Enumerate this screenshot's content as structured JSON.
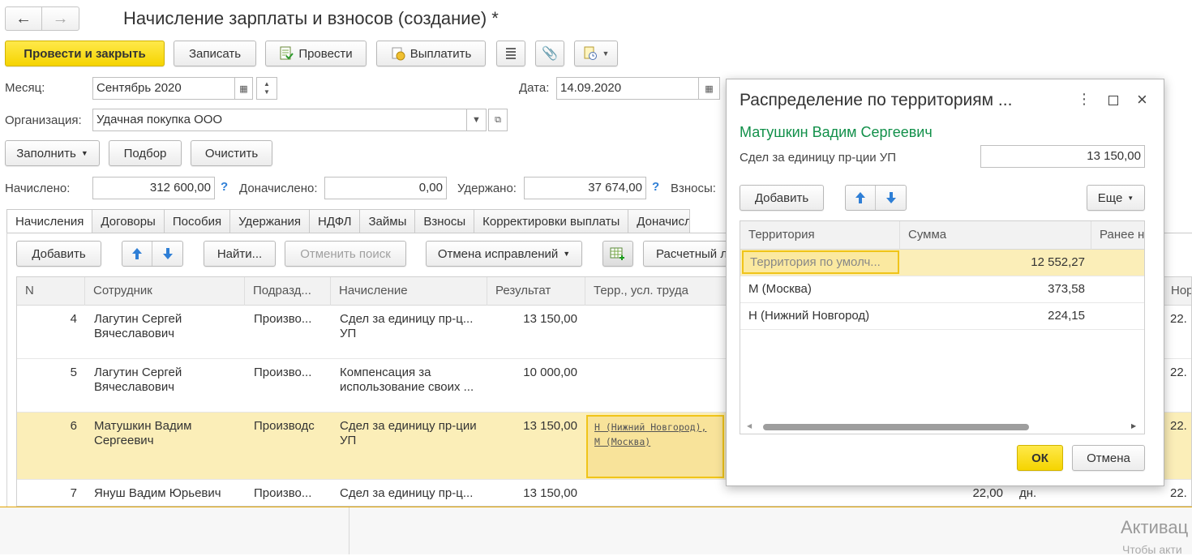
{
  "header": {
    "title": "Начисление зарплаты и взносов (создание) *"
  },
  "toolbar": {
    "post_close": "Провести и закрыть",
    "save": "Записать",
    "post": "Провести",
    "pay": "Выплатить"
  },
  "form": {
    "month_label": "Месяц:",
    "month_value": "Сентябрь 2020",
    "date_label": "Дата:",
    "date_value": "14.09.2020",
    "org_label": "Организация:",
    "org_value": "Удачная покупка ООО"
  },
  "actions": {
    "fill": "Заполнить",
    "select": "Подбор",
    "clear": "Очистить"
  },
  "totals": {
    "accrued_label": "Начислено:",
    "accrued_value": "312 600,00",
    "added_label": "Доначислено:",
    "added_value": "0,00",
    "withheld_label": "Удержано:",
    "withheld_value": "37 674,00",
    "contrib_label": "Взносы:",
    "help": "?"
  },
  "tabs": [
    "Начисления",
    "Договоры",
    "Пособия",
    "Удержания",
    "НДФЛ",
    "Займы",
    "Взносы",
    "Корректировки выплаты",
    "Доначисл"
  ],
  "grid_toolbar": {
    "add": "Добавить",
    "find": "Найти...",
    "cancel_search": "Отменить поиск",
    "cancel_fix": "Отмена исправлений",
    "calc": "Расчетный л"
  },
  "grid": {
    "columns": [
      "N",
      "Сотрудник",
      "Подразд...",
      "Начисление",
      "Результат",
      "Терр., усл. труда"
    ],
    "right_header": "Нор",
    "rows": [
      {
        "n": "4",
        "emp": "Лагутин Сергей Вячеславович",
        "dept": "Произво...",
        "acc": "Сдел за единицу пр-ц... УП",
        "res": "13 150,00",
        "terr": "",
        "right": "22."
      },
      {
        "n": "5",
        "emp": "Лагутин Сергей Вячеславович",
        "dept": "Произво...",
        "acc": "Компенсация за использование своих ...",
        "res": "10 000,00",
        "terr": "",
        "right": "22."
      },
      {
        "n": "6",
        "emp": "Матушкин Вадим Сергеевич",
        "dept": "Производс",
        "acc": "Сдел за единицу пр-ции УП",
        "res": "13 150,00",
        "terr": "Н (Нижний Новгород), М (Москва)",
        "right": "22."
      },
      {
        "n": "7",
        "emp": "Януш Вадим Юрьевич",
        "dept": "Произво...",
        "acc": "Сдел за единицу пр-ц...",
        "res": "13 150,00",
        "terr": "",
        "days": "22,00",
        "unit": "дн.",
        "right": "22."
      }
    ]
  },
  "dialog": {
    "title": "Распределение по территориям ...",
    "employee": "Матушкин Вадим Сергеевич",
    "accrual_label": "Сдел за единицу пр-ции УП",
    "accrual_value": "13 150,00",
    "add": "Добавить",
    "more": "Еще",
    "columns": [
      "Территория",
      "Сумма",
      "Ранее н"
    ],
    "rows": [
      {
        "terr": "Территория по умолч...",
        "sum": "12 552,27"
      },
      {
        "terr": "М (Москва)",
        "sum": "373,58"
      },
      {
        "terr": "Н (Нижний Новгород)",
        "sum": "224,15"
      }
    ],
    "ok": "ОК",
    "cancel": "Отмена"
  },
  "watermark": {
    "line1": "Активац",
    "line2": "Чтобы акти"
  },
  "colors": {
    "accent_yellow": "#f5d400",
    "selection": "#fbeeb8",
    "green": "#12904a",
    "arrow_blue": "#2f7fd6"
  }
}
